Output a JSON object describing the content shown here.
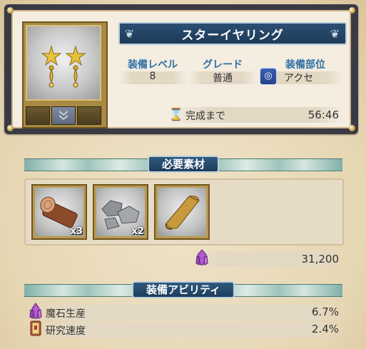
{
  "item": {
    "name": "スターイヤリング",
    "icon": "star-earrings-icon"
  },
  "stats": [
    {
      "label": "装備レベル",
      "value": "8"
    },
    {
      "label": "グレード",
      "value": "普通"
    },
    {
      "label": "装備部位",
      "value": "アクセ",
      "icon": "ring-icon"
    }
  ],
  "timer": {
    "label": "完成まで",
    "value": "56:46",
    "icon": "hourglass-icon"
  },
  "materials_section": {
    "title": "必要素材",
    "items": [
      {
        "icon": "log-icon",
        "count": "x3"
      },
      {
        "icon": "stones-icon",
        "count": "x2"
      },
      {
        "icon": "scroll-icon",
        "count": ""
      }
    ],
    "cost": {
      "icon": "magic-crystal-icon",
      "value": "31,200"
    }
  },
  "abilities_section": {
    "title": "装備アビリティ",
    "rows": [
      {
        "label": "魔石生産",
        "value": "6.7%",
        "icon": "magic-crystal-icon"
      },
      {
        "label": "研究速度",
        "value": "2.4%",
        "icon": "research-book-icon"
      }
    ]
  },
  "colors": {
    "label_blue": "#2e6fa5",
    "banner_navy": "#1e3a58",
    "frame_gold": "#b99a4c",
    "parchment": "#e9dbbd"
  }
}
